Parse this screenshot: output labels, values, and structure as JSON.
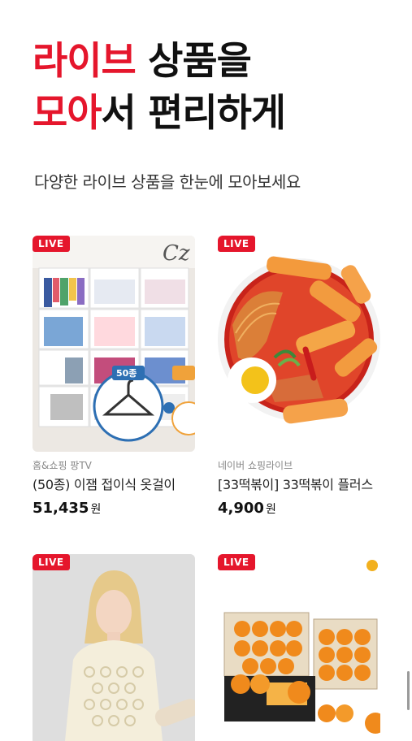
{
  "hero": {
    "line1_accent": "라이브",
    "line1_rest": " 상품을",
    "line2_accent": "모아",
    "line2_rest": "서 편리하게"
  },
  "subtitle": "다양한 라이브 상품을 한눈에 모아보세요",
  "colors": {
    "accent": "#e5162c"
  },
  "products": [
    {
      "badge": "LIVE",
      "image_text": "50종",
      "seller": "홈&쇼핑 팡TV",
      "name": "(50종) 이잼 접이식 옷걸이",
      "price": "51,435",
      "unit": "원"
    },
    {
      "badge": "LIVE",
      "seller": "네이버 쇼핑라이브",
      "name": "[33떡볶이] 33떡볶이 플러스",
      "price": "4,900",
      "unit": "원"
    },
    {
      "badge": "LIVE"
    },
    {
      "badge": "LIVE"
    }
  ]
}
